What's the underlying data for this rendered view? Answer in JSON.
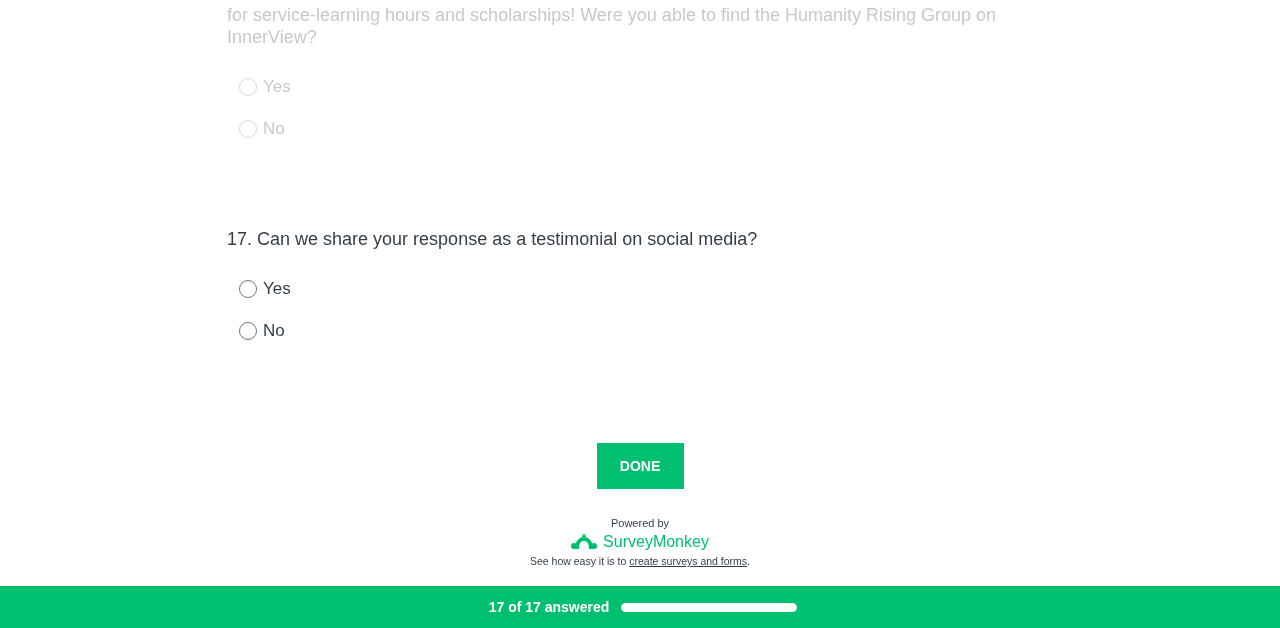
{
  "questions": [
    {
      "text": "for service-learning hours and scholarships! Were you able to find the Humanity Rising Group on InnerView?",
      "dimmed": true,
      "options": [
        {
          "label": "Yes",
          "selected": false
        },
        {
          "label": "No",
          "selected": false
        }
      ]
    },
    {
      "text": "17. Can we share your response as a testimonial on social media?",
      "dimmed": false,
      "options": [
        {
          "label": "Yes",
          "selected": false
        },
        {
          "label": "No",
          "selected": false
        }
      ]
    }
  ],
  "done_button": "DONE",
  "footer": {
    "powered_by": "Powered by",
    "brand": "SurveyMonkey",
    "tagline": "See how easy it is to",
    "link": "create surveys and forms",
    "tail": "."
  },
  "progress": {
    "label": "17 of 17 answered",
    "level": 1
  }
}
